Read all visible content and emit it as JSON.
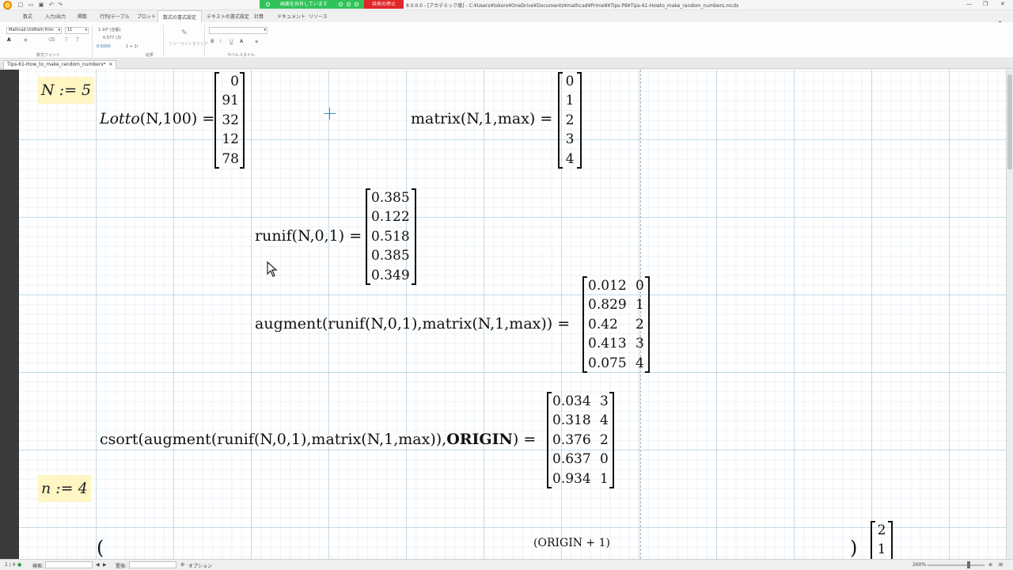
{
  "titlebar": {
    "share_status": "画面を共有しています",
    "stop_sharing": "共有の停止",
    "window_title": "8.0.0.0 - [アカデミック版] - C:¥Users¥tokoro¥OneDrive¥Documents¥mathcad¥Prime8¥Tips-P8¥Tips-61-Howto_make_random_numbers.mcdx"
  },
  "ribbon": {
    "tabs": [
      "数式",
      "入力/出力",
      "関数",
      "行列/テーブル",
      "プロット",
      "数式の書式設定",
      "テキストの書式設定",
      "計算",
      "ドキュメント",
      "リソース"
    ],
    "active_tab": "数式の書式設定",
    "font_name": "Mathcad UniMath Prim",
    "font_size": "11",
    "result_format": "1·10³ (全般)",
    "result_precision": "0.577 (3)",
    "result_example": "0.5000",
    "result_add": "1 + 1i",
    "format_painter": "フォーマットをクリア",
    "group_font": "数式フォント",
    "group_result": "結果",
    "group_label": "ラベルスタイル"
  },
  "document": {
    "tab_label": "Tips-61-How_to_make_random_numbers*"
  },
  "worksheet": {
    "def_N": "N := 5",
    "def_n": "n := 4",
    "lotto_expr": [
      "Lotto",
      "(N,100)",
      " ="
    ],
    "lotto_result": [
      "0",
      "91",
      "32",
      "12",
      "78"
    ],
    "matrix_expr": "matrix(N,1,max) =",
    "matrix_result": [
      "0",
      "1",
      "2",
      "3",
      "4"
    ],
    "runif_expr": "runif(N,0,1) =",
    "runif_result": [
      "0.385",
      "0.122",
      "0.518",
      "0.385",
      "0.349"
    ],
    "augment_expr": "augment(runif(N,0,1),matrix(N,1,max)) =",
    "augment_result": [
      [
        "0.012",
        "0"
      ],
      [
        "0.829",
        "1"
      ],
      [
        "0.42",
        "2"
      ],
      [
        "0.413",
        "3"
      ],
      [
        "0.075",
        "4"
      ]
    ],
    "csort_expr": [
      "csort(augment(runif(N,0,1),matrix(N,1,max)),",
      "ORIGIN",
      ") ="
    ],
    "csort_result": [
      [
        "0.034",
        "3"
      ],
      [
        "0.318",
        "4"
      ],
      [
        "0.376",
        "2"
      ],
      [
        "0.637",
        "0"
      ],
      [
        "0.934",
        "1"
      ]
    ],
    "bottom_superscript": "(ORIGIN + 1)",
    "bottom_partial_open": "(",
    "bottom_partial_close": ")",
    "bottom_partial_result": [
      "2",
      "1"
    ]
  },
  "statusbar": {
    "page": "1 / 4",
    "search_label": "検索:",
    "replace_label": "置換:",
    "options_label": "オプション",
    "zoom": "260%"
  },
  "colors": {
    "share_green": "#31c35a",
    "stop_red": "#e0272a",
    "definition_highlight": "#fff6c4",
    "grid_line": "#80aac8"
  }
}
